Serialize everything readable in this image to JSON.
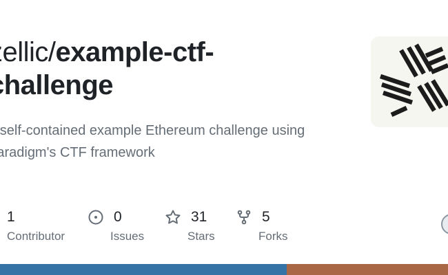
{
  "repo": {
    "owner": "zellic/",
    "name_line1": "example-ctf-",
    "name_line2": "challenge",
    "description": "A self-contained example Ethereum challenge using Paradigm's CTF framework"
  },
  "stats": {
    "contributors": {
      "count": "1",
      "label": "Contributor",
      "icon": "people-icon"
    },
    "issues": {
      "count": "0",
      "label": "Issues",
      "icon": "issue-opened-icon"
    },
    "stars": {
      "count": "31",
      "label": "Stars",
      "icon": "star-icon"
    },
    "forks": {
      "count": "5",
      "label": "Forks",
      "icon": "fork-icon"
    }
  },
  "languages": [
    {
      "color": "#3572a5",
      "share": 0.64
    },
    {
      "color": "#aa6746",
      "share": 0.36
    }
  ],
  "colors": {
    "title": "#1f2328",
    "muted": "#656d76",
    "logo_bg": "#f5f6ef",
    "logo_fg": "#1c1c1c"
  }
}
